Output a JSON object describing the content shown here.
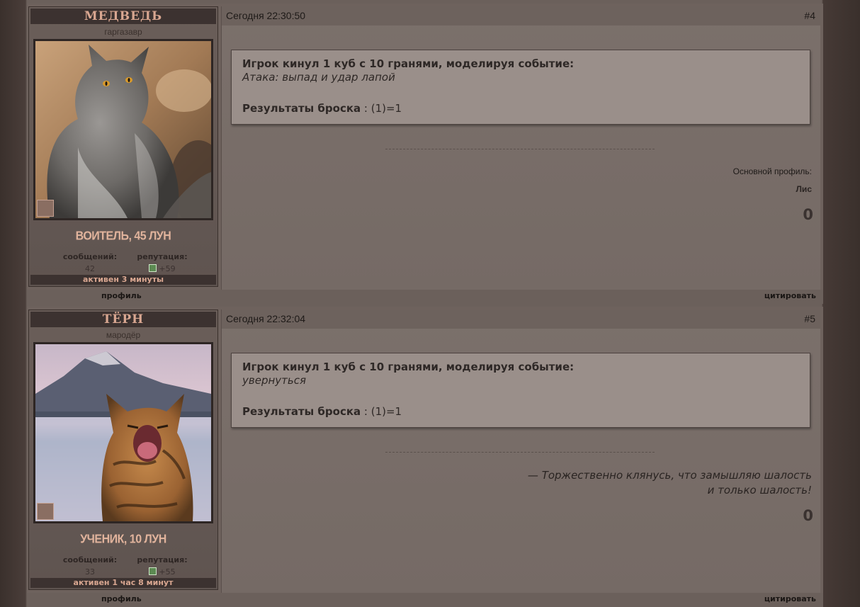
{
  "posts": [
    {
      "author": "МЕДВЕДЬ",
      "title": "гаргазавр",
      "rank": "ВОИТЕЛЬ, 45 ЛУН",
      "stats": {
        "messages_label": "сообщений:",
        "messages": "42",
        "reputation_label": "репутация:",
        "reputation": "+59"
      },
      "active": "активен 3 минуты",
      "date": "Сегодня 22:30:50",
      "number": "#4",
      "dice": {
        "head": "Игрок кинул 1 куб с 10 гранями, моделируя событие:",
        "event": "Атака: выпад и удар лапой",
        "result_label": "Результаты броска",
        "result_value": " : (1)=1"
      },
      "signature": {
        "label": "Основной профиль:",
        "link": "Лис"
      },
      "likes": "0",
      "footer": {
        "profile": "профиль",
        "quote": "цитировать"
      }
    },
    {
      "author": "ТЁРН",
      "title": "мародёр",
      "rank": "УЧЕНИК, 10 ЛУН",
      "stats": {
        "messages_label": "сообщений:",
        "messages": "33",
        "reputation_label": "репутация:",
        "reputation": "+55"
      },
      "active": "активен 1 час 8 минут",
      "date": "Сегодня 22:32:04",
      "number": "#5",
      "dice": {
        "head": "Игрок кинул 1 куб с 10 гранями, моделируя событие:",
        "event": "увернуться",
        "result_label": "Результаты броска",
        "result_value": " : (1)=1"
      },
      "signature": {
        "quote_line1": "— Торжественно клянусь, что замышляю шалость",
        "quote_line2": "и только шалость!"
      },
      "likes": "0",
      "footer": {
        "profile": "профиль",
        "quote": "цитировать"
      }
    }
  ]
}
